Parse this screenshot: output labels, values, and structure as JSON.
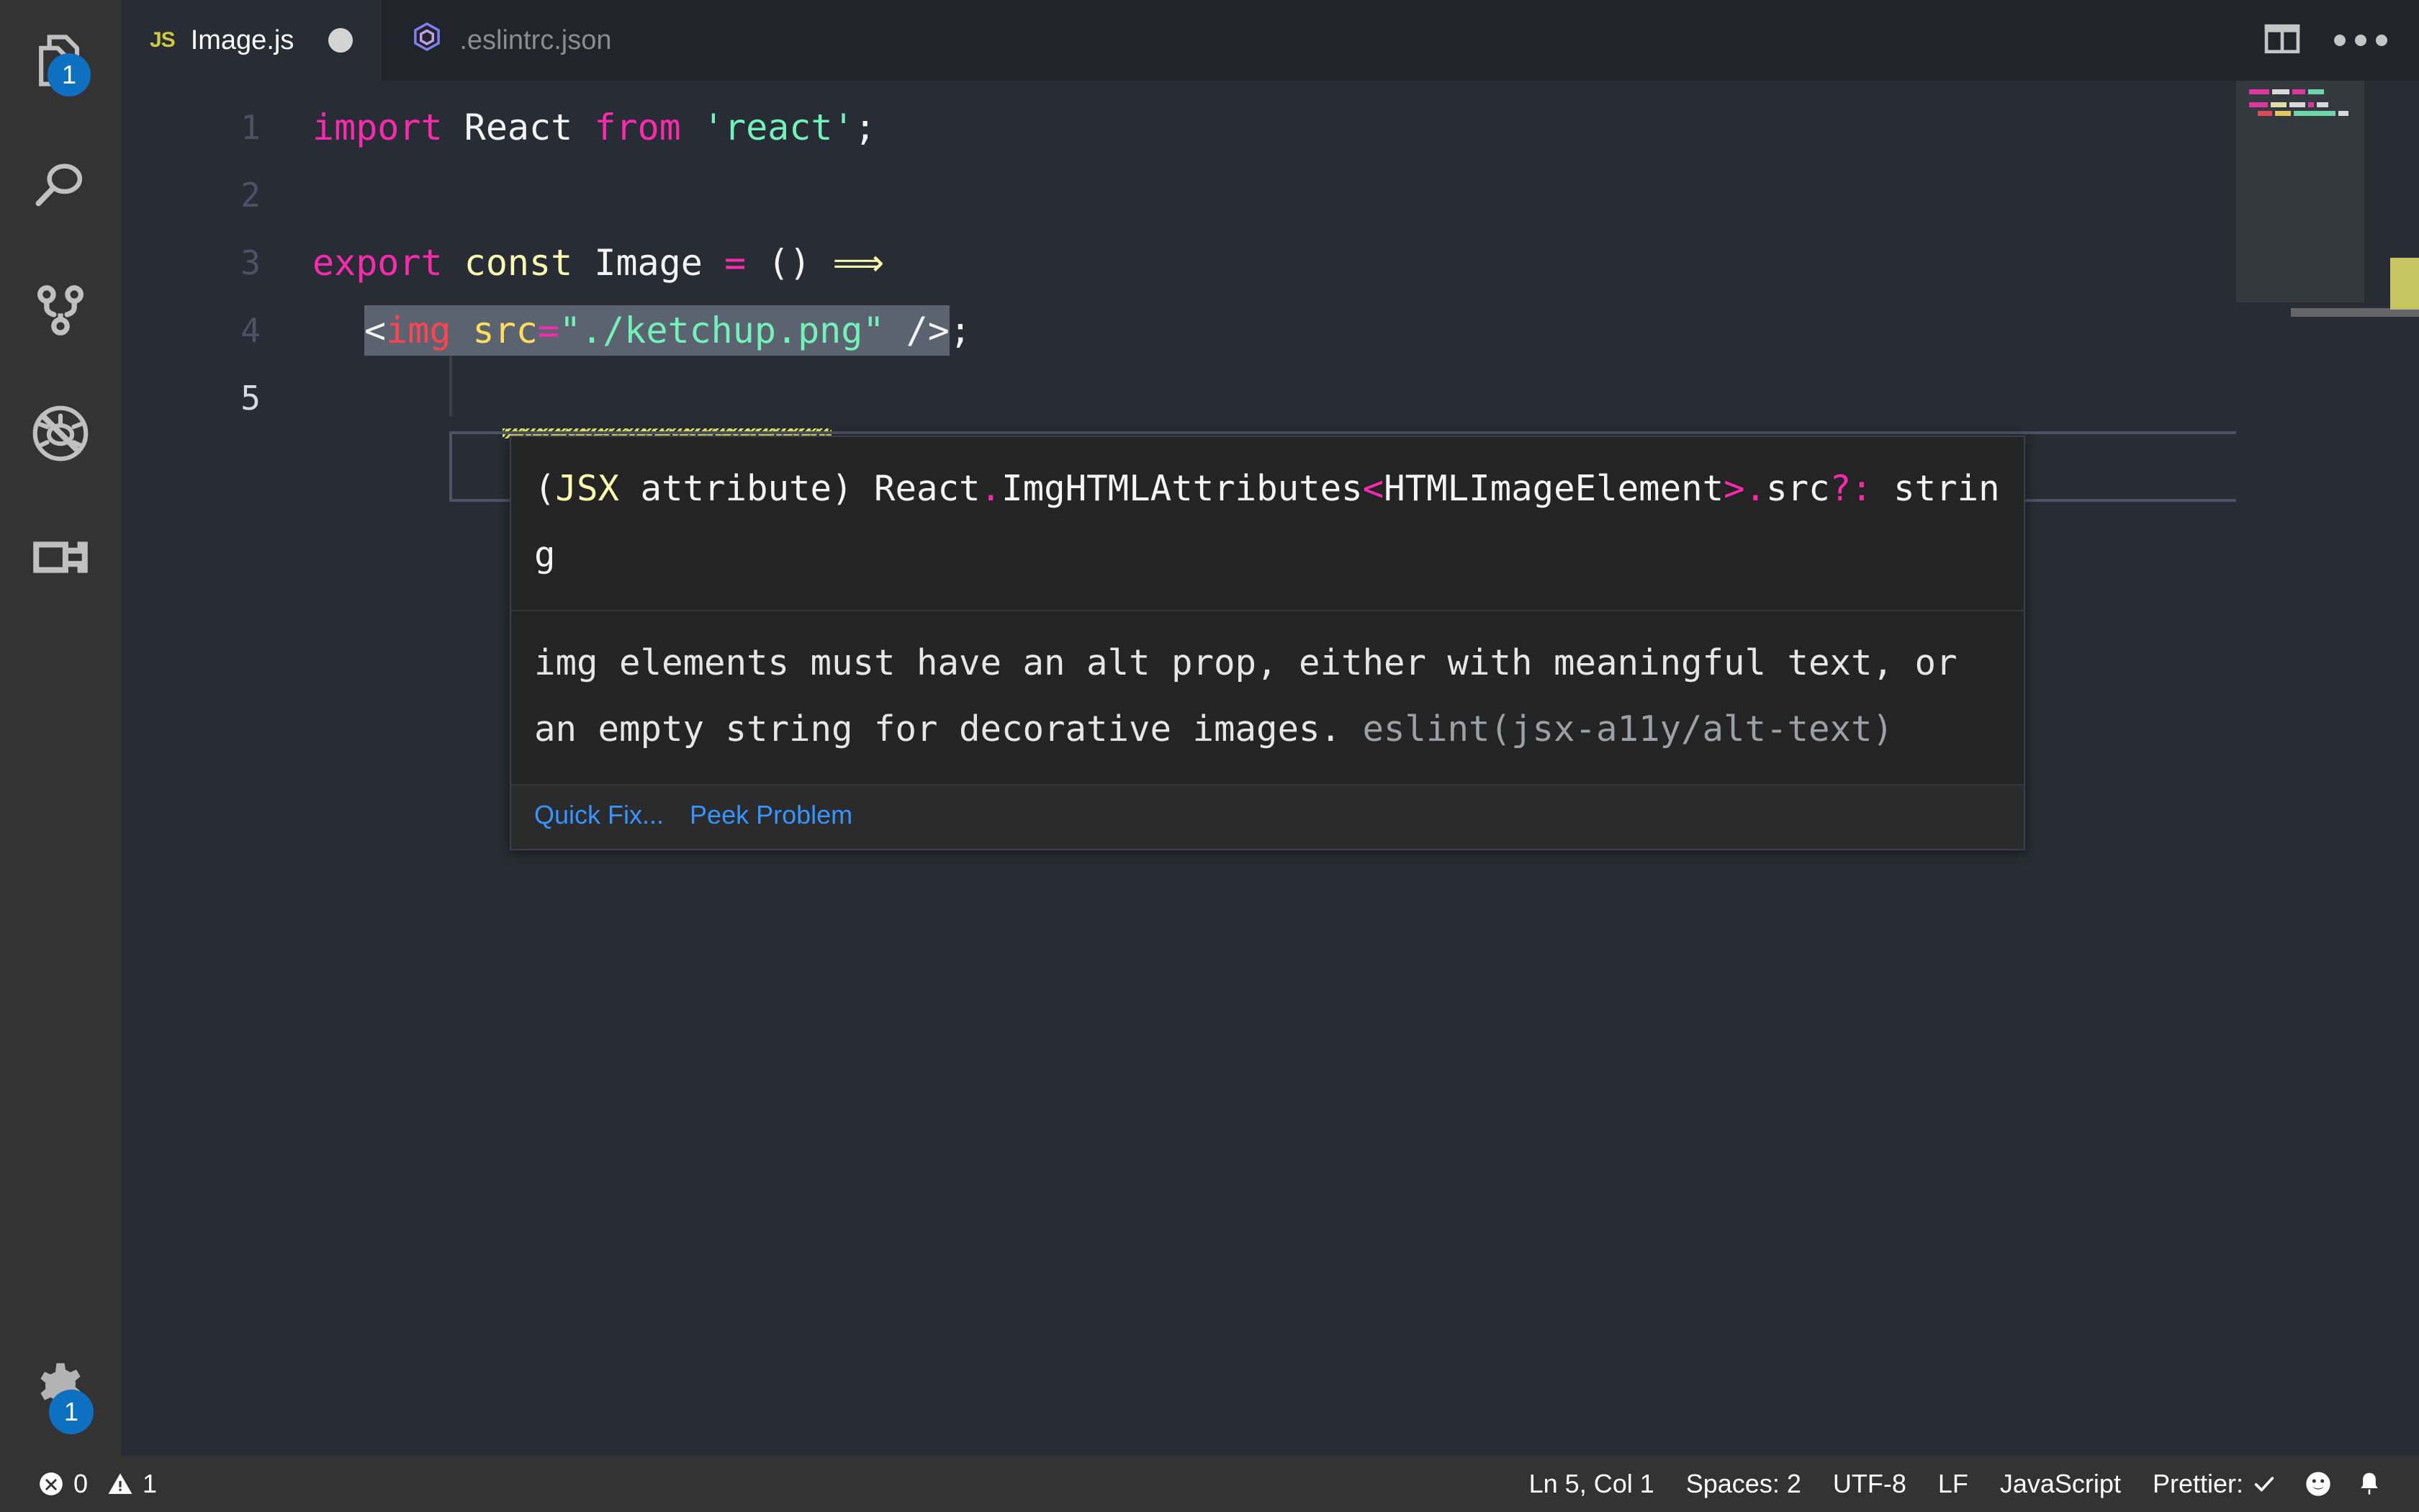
{
  "activity_bar": {
    "items": [
      {
        "name": "explorer",
        "icon": "files-icon",
        "badge": "1"
      },
      {
        "name": "search",
        "icon": "search-icon",
        "badge": null
      },
      {
        "name": "source-control",
        "icon": "source-control-icon",
        "badge": null
      },
      {
        "name": "run-and-debug",
        "icon": "debug-disabled-icon",
        "badge": null
      },
      {
        "name": "extensions",
        "icon": "extensions-icon",
        "badge": null
      }
    ],
    "bottom": [
      {
        "name": "manage",
        "icon": "gear-icon",
        "badge": "1"
      }
    ]
  },
  "tabs": [
    {
      "label": "Image.js",
      "icon": "js-file-icon",
      "icon_text": "JS",
      "active": true,
      "dirty": true
    },
    {
      "label": ".eslintrc.json",
      "icon": "eslint-file-icon",
      "active": false,
      "dirty": false
    }
  ],
  "editor_actions": {
    "split_editor": "split-editor-icon",
    "more_actions": "ellipsis-icon"
  },
  "code": {
    "lines": [
      {
        "number": "1",
        "tokens": [
          {
            "text": "import ",
            "cls": "t-kw"
          },
          {
            "text": "React ",
            "cls": "t-plain"
          },
          {
            "text": "from ",
            "cls": "t-kw"
          },
          {
            "text": "'react'",
            "cls": "t-str"
          },
          {
            "text": ";",
            "cls": "t-punc"
          }
        ]
      },
      {
        "number": "2",
        "tokens": []
      },
      {
        "number": "3",
        "tokens": [
          {
            "text": "export ",
            "cls": "t-kw"
          },
          {
            "text": "const ",
            "cls": "t-kw2"
          },
          {
            "text": "Image ",
            "cls": "t-plain"
          },
          {
            "text": "= ",
            "cls": "t-op"
          },
          {
            "text": "() ",
            "cls": "t-punc"
          },
          {
            "text": "⟹",
            "cls": "t-kw2"
          }
        ]
      },
      {
        "number": "4",
        "tokens": [
          {
            "text": "<",
            "cls": "t-punc"
          },
          {
            "text": "img",
            "cls": "t-tag"
          },
          {
            "text": " src",
            "cls": "t-attr"
          },
          {
            "text": "=",
            "cls": "t-op"
          },
          {
            "text": "\"./ketchup.png\"",
            "cls": "t-str"
          },
          {
            "text": " />",
            "cls": "t-punc"
          }
        ],
        "trailing": ";"
      },
      {
        "number": "5",
        "tokens": []
      }
    ]
  },
  "hover": {
    "signature_parts": [
      {
        "text": "(",
        "cls": "t-plain"
      },
      {
        "text": "JSX",
        "cls": "h-jsx"
      },
      {
        "text": " attribute) React",
        "cls": "t-plain"
      },
      {
        "text": ".",
        "cls": "h-pink"
      },
      {
        "text": "ImgHTMLAttributes",
        "cls": "t-plain"
      },
      {
        "text": "<",
        "cls": "h-pink"
      },
      {
        "text": "HTMLImageElement",
        "cls": "t-plain"
      },
      {
        "text": ">",
        "cls": "h-pink"
      },
      {
        "text": ".",
        "cls": "h-pink"
      },
      {
        "text": "src",
        "cls": "t-plain"
      },
      {
        "text": "?:",
        "cls": "h-pink"
      },
      {
        "text": " string",
        "cls": "t-plain"
      }
    ],
    "message": "img elements must have an alt prop, either with meaningful text, or an empty string for decorative images.",
    "source": "eslint(jsx-a11y/alt-text)",
    "actions": [
      {
        "label": "Quick Fix...",
        "name": "quick-fix-link"
      },
      {
        "label": "Peek Problem",
        "name": "peek-problem-link"
      }
    ]
  },
  "status_bar": {
    "errors_icon": "error-circle-icon",
    "errors": "0",
    "warnings_icon": "warning-triangle-icon",
    "warnings": "1",
    "cursor_position": "Ln 5, Col 1",
    "indentation": "Spaces: 2",
    "encoding": "UTF-8",
    "eol": "LF",
    "language": "JavaScript",
    "formatter": "Prettier:",
    "formatter_state_icon": "check-icon",
    "feedback_icon": "smiley-icon",
    "notifications_icon": "bell-icon"
  },
  "colors": {
    "accent_badge": "#0e70c0",
    "editor_bg": "#282c34",
    "chrome_bg": "#21252b",
    "activity_bg": "#333333",
    "link": "#3794ff",
    "warning": "#e2e26a",
    "string": "#72f1b8",
    "keyword": "#f92aad",
    "tag": "#fe4450",
    "attribute": "#fede5d"
  }
}
